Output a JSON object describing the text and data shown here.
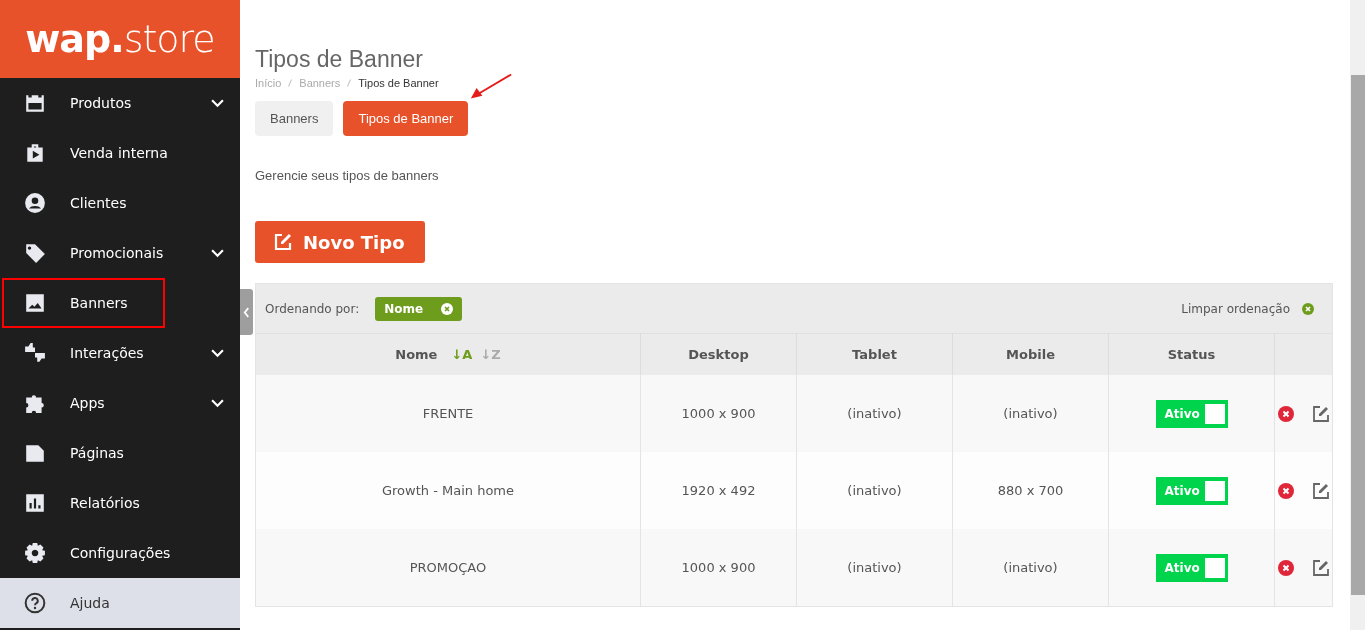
{
  "sidebar": {
    "logo": {
      "bold": "wap.",
      "light": "store"
    },
    "items": [
      {
        "label": "Produtos",
        "expandable": true,
        "highlighted": false,
        "selected": false
      },
      {
        "label": "Venda interna",
        "expandable": false,
        "highlighted": false,
        "selected": false
      },
      {
        "label": "Clientes",
        "expandable": false,
        "highlighted": false,
        "selected": false
      },
      {
        "label": "Promocionais",
        "expandable": true,
        "highlighted": false,
        "selected": false
      },
      {
        "label": "Banners",
        "expandable": false,
        "highlighted": true,
        "selected": false
      },
      {
        "label": "Interações",
        "expandable": true,
        "highlighted": false,
        "selected": false
      },
      {
        "label": "Apps",
        "expandable": true,
        "highlighted": false,
        "selected": false
      },
      {
        "label": "Páginas",
        "expandable": false,
        "highlighted": false,
        "selected": false
      },
      {
        "label": "Relatórios",
        "expandable": false,
        "highlighted": false,
        "selected": false
      },
      {
        "label": "Configurações",
        "expandable": false,
        "highlighted": false,
        "selected": false
      },
      {
        "label": "Ajuda",
        "expandable": false,
        "highlighted": false,
        "selected": true
      }
    ]
  },
  "page": {
    "title": "Tipos de Banner",
    "breadcrumb": [
      {
        "label": "Início",
        "current": false
      },
      {
        "label": "Banners",
        "current": false
      },
      {
        "label": "Tipos de Banner",
        "current": true
      }
    ],
    "tabs": [
      {
        "label": "Banners",
        "selected": false
      },
      {
        "label": "Tipos de Banner",
        "selected": true
      }
    ],
    "description": "Gerencie seus tipos de banners",
    "new_button": "Novo Tipo"
  },
  "table": {
    "sort_label": "Ordenando por:",
    "sort_chip": "Nome",
    "clear_sort": "Limpar ordenação",
    "columns": [
      {
        "label": "Nome",
        "sort": [
          {
            "label": "↓A",
            "selected": true
          },
          {
            "label": "↓Z",
            "selected": false
          }
        ]
      },
      {
        "label": "Desktop"
      },
      {
        "label": "Tablet"
      },
      {
        "label": "Mobile"
      },
      {
        "label": "Status"
      }
    ],
    "rows": [
      {
        "name": "FRENTE",
        "desktop": "1000 x 900",
        "tablet": "(inativo)",
        "mobile": "(inativo)",
        "status": "Ativo",
        "on": true
      },
      {
        "name": "Growth - Main home",
        "desktop": "1920 x 492",
        "tablet": "(inativo)",
        "mobile": "880 x 700",
        "status": "Ativo",
        "on": true
      },
      {
        "name": "PROMOÇAO",
        "desktop": "1000 x 900",
        "tablet": "(inativo)",
        "mobile": "(inativo)",
        "status": "Ativo",
        "on": true
      }
    ]
  }
}
